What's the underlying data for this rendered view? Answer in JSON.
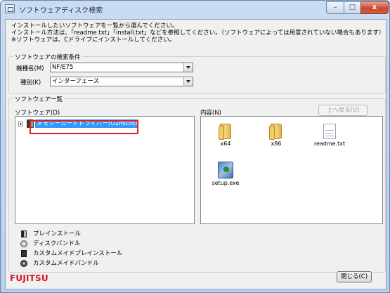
{
  "window": {
    "title": "ソフトウェアディスク検索",
    "minimize_glyph": "–",
    "maximize_glyph": "□",
    "close_glyph": "x"
  },
  "intro": {
    "line1": "インストールしたいソフトウェアを一覧から選んでください。",
    "line2": "インストール方法は、「readme.txt」「install.txt」などを参照してください。（ソフトウェアによっては用意されていない場合もあります）",
    "line3": "※ソフトウェアは、Cドライブにインストールしてください。"
  },
  "search": {
    "group_label": "ソフトウェアの検索条件",
    "model_label": "機種名(M)",
    "model_value": "NF/E75",
    "type_label": "種別(K)",
    "type_value": "インターフェース"
  },
  "list": {
    "group_label": "ソフトウェア一覧",
    "software_label": "ソフトウェア(D)",
    "content_label": "内容(N)",
    "up_button": "上へ戻る(U)",
    "tree_item": "メモリーカードドライバー(O2Micro)",
    "files": [
      {
        "name": "x64",
        "icon": "folder-icon"
      },
      {
        "name": "x86",
        "icon": "folder-icon"
      },
      {
        "name": "readme.txt",
        "icon": "text-document-icon"
      },
      {
        "name": "setup.exe",
        "icon": "installer-icon"
      }
    ]
  },
  "legend": {
    "items": [
      {
        "label": "プレインストール",
        "icon": "preinstall-icon"
      },
      {
        "label": "ディスクバンドル",
        "icon": "disc-bundle-icon"
      },
      {
        "label": "カスタムメイドプレインストール",
        "icon": "custom-preinstall-icon"
      },
      {
        "label": "カスタムメイドバンドル",
        "icon": "custom-bundle-icon"
      }
    ]
  },
  "footer": {
    "brand": "FUJITSU",
    "close_button": "閉じる(C)"
  },
  "colors": {
    "selection": "#3399ff",
    "highlight_box": "#e02020",
    "brand": "#d8141e"
  }
}
